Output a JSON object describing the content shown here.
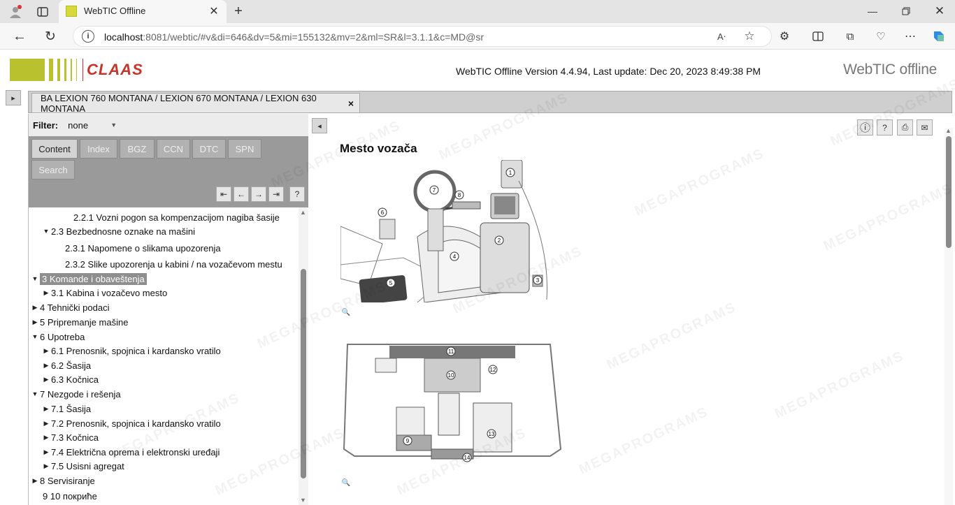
{
  "browser": {
    "tab_title": "WebTIC Offline",
    "url_host": "localhost",
    "url_rest": ":8081/webtic/#v&di=646&dv=5&mi=155132&mv=2&ml=SR&l=3.1.1&c=MD@sr"
  },
  "header": {
    "logo_text": "CLAAS",
    "version_text": "WebTIC Offline Version 4.4.94, Last update: Dec 20, 2023 8:49:38 PM",
    "brand": "WebTIC offline",
    "brand_color": "#8cc63f"
  },
  "doc_tab": {
    "title": "BA LEXION 760 MONTANA / LEXION 670 MONTANA / LEXION 630 MONTANA",
    "close": "×"
  },
  "filter": {
    "label": "Filter:",
    "value": "none"
  },
  "nav_tabs": [
    "Content",
    "Index",
    "BGZ",
    "CCN",
    "DTC",
    "SPN",
    "Search"
  ],
  "nav_buttons": [
    "⇤",
    "←",
    "→",
    "⇥",
    "?"
  ],
  "tree": [
    {
      "label": "2.2.1 Vozni pogon sa kompenzacijom nagiba šasije",
      "toggle": ""
    },
    {
      "label": "2.3 Bezbednosne oznake na mašini",
      "toggle": "▼"
    },
    {
      "label": "2.3.1 Napomene o slikama upozorenja",
      "toggle": ""
    },
    {
      "label": "2.3.2 Slike upozorenja u kabini / na vozačevom mestu",
      "toggle": ""
    },
    {
      "label": "3 Komande i obaveštenja",
      "toggle": "▼"
    },
    {
      "label": "3.1 Kabina i vozačevo mesto",
      "toggle": "▶"
    },
    {
      "label": "4 Tehnički podaci",
      "toggle": "▶"
    },
    {
      "label": "5 Pripremanje mašine",
      "toggle": "▶"
    },
    {
      "label": "6 Upotreba",
      "toggle": "▼"
    },
    {
      "label": "6.1 Prenosnik, spojnica i kardansko vratilo",
      "toggle": "▶"
    },
    {
      "label": "6.2 Šasija",
      "toggle": "▶"
    },
    {
      "label": "6.3 Kočnica",
      "toggle": "▶"
    },
    {
      "label": "7 Nezgode i rešenja",
      "toggle": "▼"
    },
    {
      "label": "7.1 Šasija",
      "toggle": "▶"
    },
    {
      "label": "7.2 Prenosnik, spojnica i kardansko vratilo",
      "toggle": "▶"
    },
    {
      "label": "7.3 Kočnica",
      "toggle": "▶"
    },
    {
      "label": "7.4 Električna oprema i elektronski uređaji",
      "toggle": "▶"
    },
    {
      "label": "7.5 Usisni agregat",
      "toggle": "▶"
    },
    {
      "label": "8 Servisiranje",
      "toggle": "▶"
    },
    {
      "label": "9 10 покриће",
      "toggle": ""
    }
  ],
  "content": {
    "title": "Mesto vozača",
    "tool_buttons": [
      "ⓘ",
      "?",
      "⎙",
      "✉"
    ],
    "figure1_labels": [
      "1",
      "2",
      "3",
      "4",
      "5",
      "6",
      "7",
      "8"
    ],
    "figure2_labels": [
      "9",
      "10",
      "11",
      "12",
      "13",
      "14"
    ]
  },
  "watermark": "MEGAPROGRAMS"
}
